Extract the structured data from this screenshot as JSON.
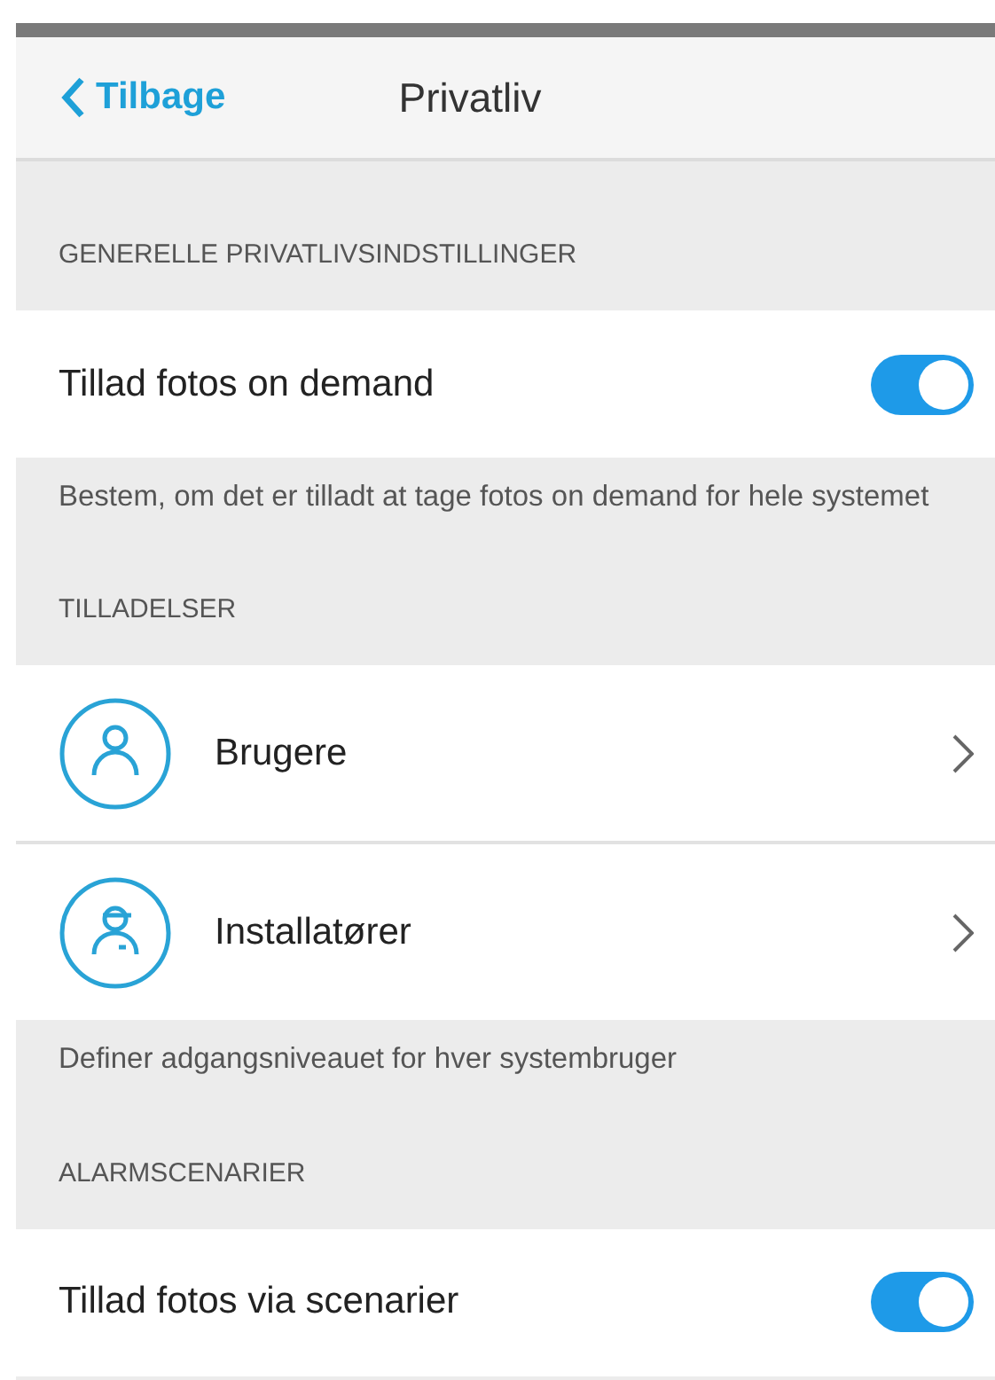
{
  "header": {
    "back": "Tilbage",
    "title": "Privatliv"
  },
  "sections": [
    {
      "header": "GENERELLE PRIVATLIVSINDSTILLINGER",
      "rows": [
        {
          "kind": "toggle",
          "label": "Tillad fotos on demand",
          "on": true
        }
      ],
      "footer": "Bestem, om det er tilladt at tage fotos on demand for hele systemet"
    },
    {
      "header": "TILLADELSER",
      "rows": [
        {
          "kind": "link",
          "label": "Brugere"
        },
        {
          "kind": "link",
          "label": "Installatører"
        }
      ],
      "footer": "Definer adgangsniveauet for hver systembruger"
    },
    {
      "header": "ALARMSCENARIER",
      "rows": [
        {
          "kind": "toggle",
          "label": "Tillad fotos via scenarier",
          "on": true
        }
      ]
    }
  ]
}
